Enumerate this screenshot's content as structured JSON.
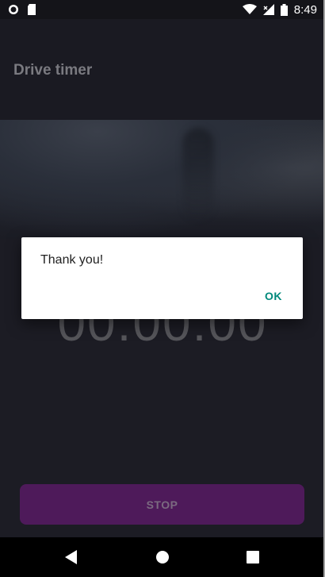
{
  "status_bar": {
    "time": "8:49",
    "icons": [
      "circle-notification-icon",
      "sd-card-icon",
      "wifi-icon",
      "signal-icon",
      "battery-icon"
    ]
  },
  "app": {
    "title": "Drive timer"
  },
  "timer": {
    "value": "00:00:00"
  },
  "stop_button": {
    "label": "STOP"
  },
  "dialog": {
    "message": "Thank you!",
    "ok_label": "OK"
  },
  "nav_bar": {
    "icons": [
      "back-icon",
      "home-icon",
      "recents-icon"
    ]
  },
  "colors": {
    "accent": "#00897b",
    "button": "#4e1a5a"
  }
}
